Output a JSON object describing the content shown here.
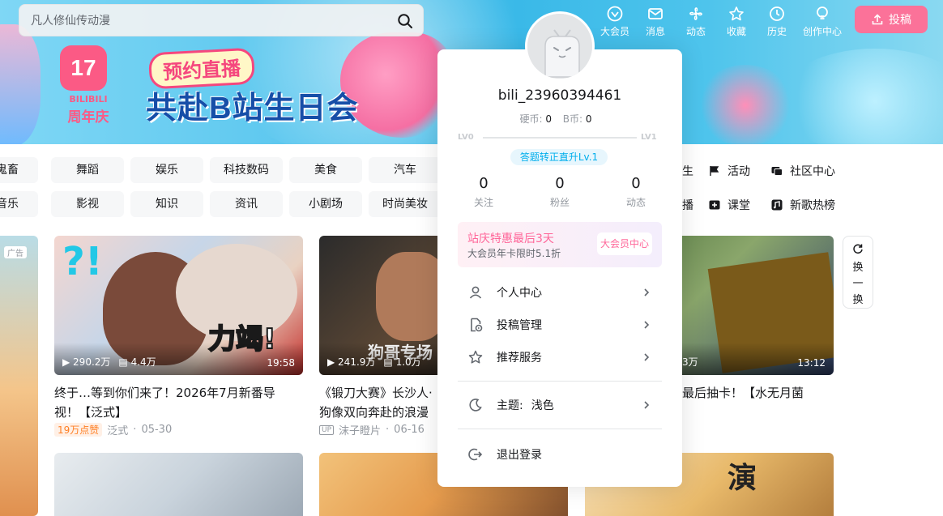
{
  "search": {
    "placeholder": "凡人修仙传动漫"
  },
  "topnav": {
    "items": [
      {
        "label": "大会员"
      },
      {
        "label": "消息"
      },
      {
        "label": "动态"
      },
      {
        "label": "收藏"
      },
      {
        "label": "历史"
      },
      {
        "label": "创作中心"
      }
    ],
    "upload_label": "投稿"
  },
  "banner": {
    "logo_number": "17",
    "logo_line1": "BILIBILI",
    "logo_line2": "周年庆",
    "pill": "预约直播",
    "title": "共赴B站生日会"
  },
  "categories": {
    "row1": [
      "鬼畜",
      "舞蹈",
      "娱乐",
      "科技数码",
      "美食",
      "汽车"
    ],
    "row2": [
      "音乐",
      "影视",
      "知识",
      "资讯",
      "小剧场",
      "时尚美妆"
    ]
  },
  "right_links": {
    "row1_partial": "生",
    "row2_partial": "播",
    "activity": "活动",
    "community": "社区中心",
    "class": "课堂",
    "songs": "新歌热榜"
  },
  "videos": [
    {
      "plays": "290.2万",
      "danmaku": "4.4万",
      "duration": "19:58",
      "title": "终于…等到你们来了！2026年7月新番导视！【泛式】",
      "badge": "19万点赞",
      "author": "泛式",
      "date": "05-30"
    },
    {
      "plays": "241.9万",
      "danmaku": "1.0万",
      "duration": "",
      "title": "《锻刀大赛》长沙人·狗像双向奔赴的浪漫",
      "badge": "",
      "author": "沫子瞪片",
      "date": "06-16",
      "author_tag": "UP"
    },
    {
      "plays": "",
      "danmaku": "3万",
      "duration": "13:12",
      "title": "最后抽卡！【水无月菌",
      "badge": "",
      "author": "",
      "date": ""
    }
  ],
  "ad_label": "广告",
  "refresh_label": [
    "换",
    "一",
    "换"
  ],
  "profile": {
    "username": "bili_23960394461",
    "coin_label": "硬币:",
    "coin_value": "0",
    "bcoin_label": "B币:",
    "bcoin_value": "0",
    "lv_current": "LV0",
    "lv_next": "LV1",
    "lv_tag": "答题转正直升Lv.1",
    "counts": [
      {
        "n": "0",
        "l": "关注"
      },
      {
        "n": "0",
        "l": "粉丝"
      },
      {
        "n": "0",
        "l": "动态"
      }
    ],
    "vip_title": "站庆特惠最后3天",
    "vip_sub": "大会员年卡限时5.1折",
    "vip_button": "大会员中心",
    "menu": [
      "个人中心",
      "投稿管理",
      "推荐服务"
    ],
    "theme_label": "主题:",
    "theme_value": "浅色",
    "logout": "退出登录"
  },
  "colors": {
    "pink": "#fb7299",
    "blue": "#00aeec",
    "text": "#18191c",
    "gray": "#9499a0"
  }
}
